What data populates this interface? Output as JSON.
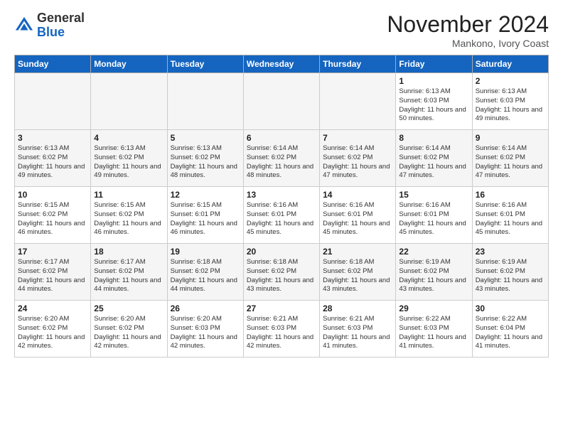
{
  "header": {
    "logo_general": "General",
    "logo_blue": "Blue",
    "month": "November 2024",
    "location": "Mankono, Ivory Coast"
  },
  "days_of_week": [
    "Sunday",
    "Monday",
    "Tuesday",
    "Wednesday",
    "Thursday",
    "Friday",
    "Saturday"
  ],
  "weeks": [
    {
      "days": [
        {
          "num": "",
          "info": ""
        },
        {
          "num": "",
          "info": ""
        },
        {
          "num": "",
          "info": ""
        },
        {
          "num": "",
          "info": ""
        },
        {
          "num": "",
          "info": ""
        },
        {
          "num": "1",
          "info": "Sunrise: 6:13 AM\nSunset: 6:03 PM\nDaylight: 11 hours and 50 minutes."
        },
        {
          "num": "2",
          "info": "Sunrise: 6:13 AM\nSunset: 6:03 PM\nDaylight: 11 hours and 49 minutes."
        }
      ]
    },
    {
      "days": [
        {
          "num": "3",
          "info": "Sunrise: 6:13 AM\nSunset: 6:02 PM\nDaylight: 11 hours and 49 minutes."
        },
        {
          "num": "4",
          "info": "Sunrise: 6:13 AM\nSunset: 6:02 PM\nDaylight: 11 hours and 49 minutes."
        },
        {
          "num": "5",
          "info": "Sunrise: 6:13 AM\nSunset: 6:02 PM\nDaylight: 11 hours and 48 minutes."
        },
        {
          "num": "6",
          "info": "Sunrise: 6:14 AM\nSunset: 6:02 PM\nDaylight: 11 hours and 48 minutes."
        },
        {
          "num": "7",
          "info": "Sunrise: 6:14 AM\nSunset: 6:02 PM\nDaylight: 11 hours and 47 minutes."
        },
        {
          "num": "8",
          "info": "Sunrise: 6:14 AM\nSunset: 6:02 PM\nDaylight: 11 hours and 47 minutes."
        },
        {
          "num": "9",
          "info": "Sunrise: 6:14 AM\nSunset: 6:02 PM\nDaylight: 11 hours and 47 minutes."
        }
      ]
    },
    {
      "days": [
        {
          "num": "10",
          "info": "Sunrise: 6:15 AM\nSunset: 6:02 PM\nDaylight: 11 hours and 46 minutes."
        },
        {
          "num": "11",
          "info": "Sunrise: 6:15 AM\nSunset: 6:02 PM\nDaylight: 11 hours and 46 minutes."
        },
        {
          "num": "12",
          "info": "Sunrise: 6:15 AM\nSunset: 6:01 PM\nDaylight: 11 hours and 46 minutes."
        },
        {
          "num": "13",
          "info": "Sunrise: 6:16 AM\nSunset: 6:01 PM\nDaylight: 11 hours and 45 minutes."
        },
        {
          "num": "14",
          "info": "Sunrise: 6:16 AM\nSunset: 6:01 PM\nDaylight: 11 hours and 45 minutes."
        },
        {
          "num": "15",
          "info": "Sunrise: 6:16 AM\nSunset: 6:01 PM\nDaylight: 11 hours and 45 minutes."
        },
        {
          "num": "16",
          "info": "Sunrise: 6:16 AM\nSunset: 6:01 PM\nDaylight: 11 hours and 45 minutes."
        }
      ]
    },
    {
      "days": [
        {
          "num": "17",
          "info": "Sunrise: 6:17 AM\nSunset: 6:02 PM\nDaylight: 11 hours and 44 minutes."
        },
        {
          "num": "18",
          "info": "Sunrise: 6:17 AM\nSunset: 6:02 PM\nDaylight: 11 hours and 44 minutes."
        },
        {
          "num": "19",
          "info": "Sunrise: 6:18 AM\nSunset: 6:02 PM\nDaylight: 11 hours and 44 minutes."
        },
        {
          "num": "20",
          "info": "Sunrise: 6:18 AM\nSunset: 6:02 PM\nDaylight: 11 hours and 43 minutes."
        },
        {
          "num": "21",
          "info": "Sunrise: 6:18 AM\nSunset: 6:02 PM\nDaylight: 11 hours and 43 minutes."
        },
        {
          "num": "22",
          "info": "Sunrise: 6:19 AM\nSunset: 6:02 PM\nDaylight: 11 hours and 43 minutes."
        },
        {
          "num": "23",
          "info": "Sunrise: 6:19 AM\nSunset: 6:02 PM\nDaylight: 11 hours and 43 minutes."
        }
      ]
    },
    {
      "days": [
        {
          "num": "24",
          "info": "Sunrise: 6:20 AM\nSunset: 6:02 PM\nDaylight: 11 hours and 42 minutes."
        },
        {
          "num": "25",
          "info": "Sunrise: 6:20 AM\nSunset: 6:02 PM\nDaylight: 11 hours and 42 minutes."
        },
        {
          "num": "26",
          "info": "Sunrise: 6:20 AM\nSunset: 6:03 PM\nDaylight: 11 hours and 42 minutes."
        },
        {
          "num": "27",
          "info": "Sunrise: 6:21 AM\nSunset: 6:03 PM\nDaylight: 11 hours and 42 minutes."
        },
        {
          "num": "28",
          "info": "Sunrise: 6:21 AM\nSunset: 6:03 PM\nDaylight: 11 hours and 41 minutes."
        },
        {
          "num": "29",
          "info": "Sunrise: 6:22 AM\nSunset: 6:03 PM\nDaylight: 11 hours and 41 minutes."
        },
        {
          "num": "30",
          "info": "Sunrise: 6:22 AM\nSunset: 6:04 PM\nDaylight: 11 hours and 41 minutes."
        }
      ]
    }
  ]
}
